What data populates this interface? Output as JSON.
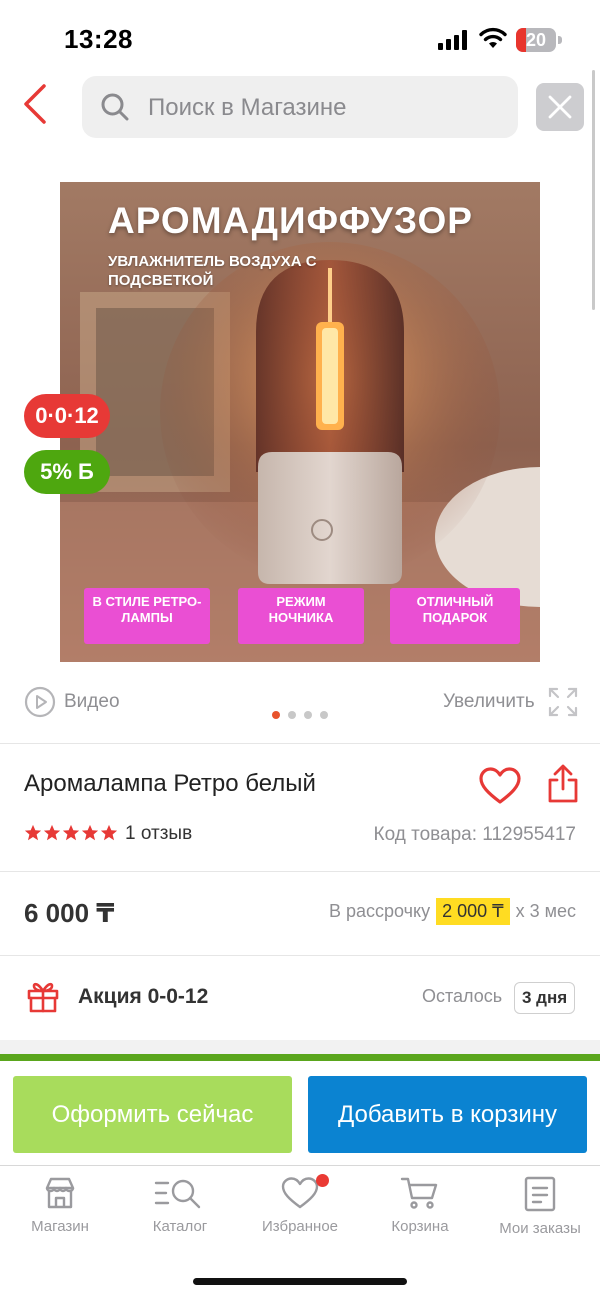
{
  "status_bar": {
    "time": "13:28",
    "battery": "20"
  },
  "header": {
    "search_placeholder": "Поиск в Магазине"
  },
  "gallery": {
    "headline": "АРОМАДИФФУЗОР",
    "subheadline": "УВЛАЖНИТЕЛЬ ВОЗДУХА С ПОДСВЕТКОЙ",
    "tags": [
      "В СТИЛЕ РЕТРО-ЛАМПЫ",
      "РЕЖИМ НОЧНИКА",
      "ОТЛИЧНЫЙ ПОДАРОК"
    ],
    "badge_promo": "0·0·12",
    "badge_bonus": "5% Б",
    "video_label": "Видео",
    "zoom_label": "Увеличить",
    "page_count": 4,
    "active_page": 1
  },
  "product": {
    "title": "Аромалампа Ретро белый",
    "rating": 5,
    "reviews": "1 отзыв",
    "code": "Код товара: 112955417",
    "price": "6 000 ₸",
    "installment_prefix": "В рассрочку",
    "installment_amount": "2 000 ₸",
    "installment_suffix": "х 3 мес",
    "promo": "Акция 0-0-12",
    "remaining_label": "Осталось",
    "remaining_value": "3 дня"
  },
  "actions": {
    "order_now": "Оформить сейчас",
    "add_to_cart": "Добавить в корзину"
  },
  "tabbar": {
    "items": [
      {
        "label": "Магазин",
        "icon": "store-icon"
      },
      {
        "label": "Каталог",
        "icon": "catalog-search-icon"
      },
      {
        "label": "Избранное",
        "icon": "heart-icon"
      },
      {
        "label": "Корзина",
        "icon": "cart-icon"
      },
      {
        "label": "Мои заказы",
        "icon": "orders-icon"
      }
    ]
  },
  "colors": {
    "accent_red": "#e73936",
    "bonus_green": "#4ea70f",
    "order_button": "#a8dc5c",
    "cart_button": "#0b83d1",
    "installment_highlight": "#ffdc22"
  }
}
